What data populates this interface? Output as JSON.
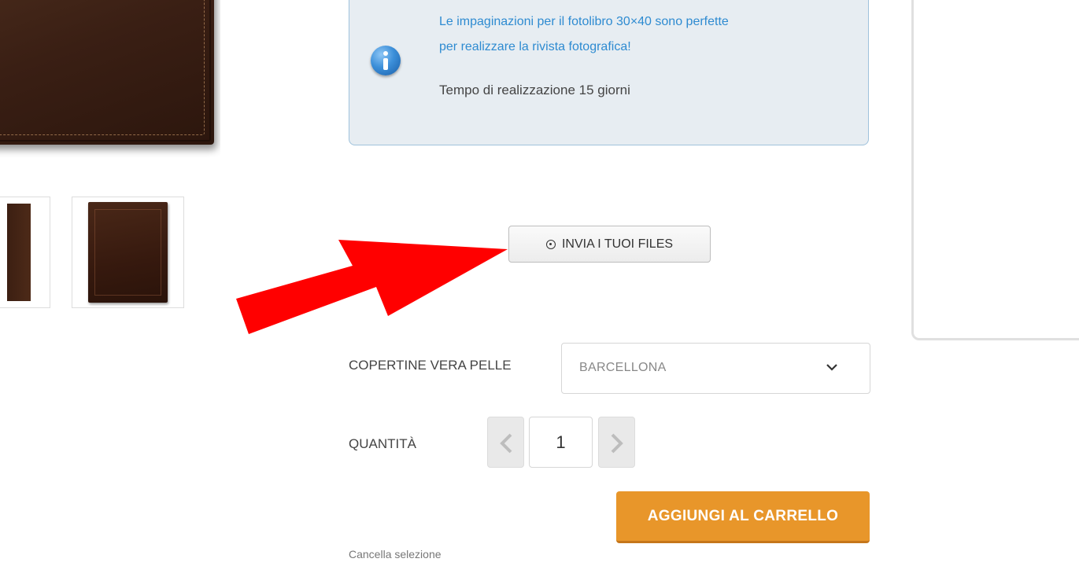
{
  "info": {
    "link_line1": "Le impaginazioni per il fotolibro 30×40 sono perfette",
    "link_line2": "per realizzare la rivista fotografica!",
    "production_time": "Tempo di realizzazione 15 giorni"
  },
  "upload": {
    "icon": "upload-circle-icon",
    "label": "INVIA I TUOI FILES"
  },
  "options": {
    "cover_label": "COPERTINE VERA PELLE",
    "cover_value": "BARCELLONA"
  },
  "quantity": {
    "label": "QUANTITÀ",
    "value": "1"
  },
  "cart": {
    "add_label": "AGGIUNGI AL CARRELLO"
  },
  "clear_label": "Cancella selezione",
  "colors": {
    "accent_orange": "#e8962a",
    "info_link_blue": "#2e8bd1",
    "arrow_red": "#ff0000"
  }
}
